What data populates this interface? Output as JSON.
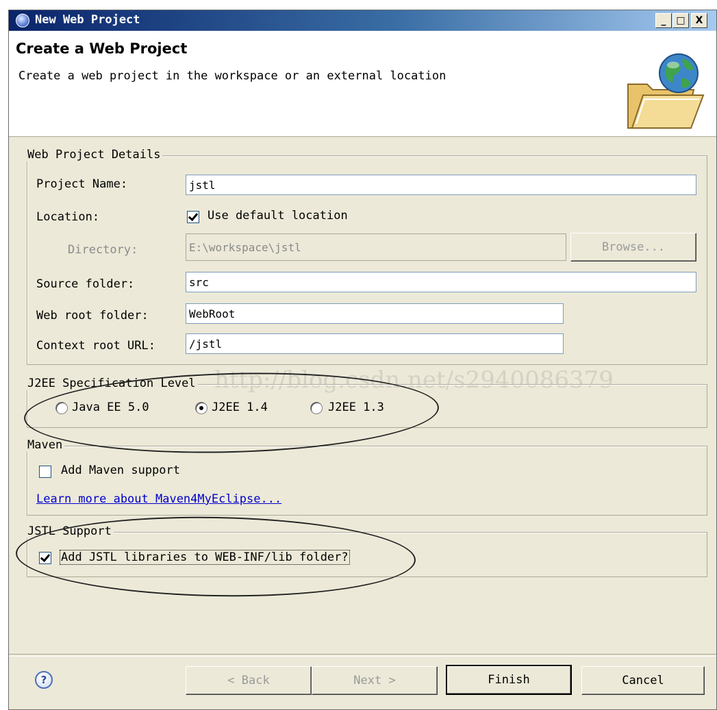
{
  "window": {
    "title": "New Web Project",
    "buttons": {
      "minimize": "_",
      "maximize": "□",
      "close": "X"
    }
  },
  "header": {
    "title": "Create a Web Project",
    "description": "Create a web project in the workspace or an external location"
  },
  "details": {
    "legend": "Web Project Details",
    "project_name_label": "Project Name:",
    "project_name_value": "jstl",
    "location_label": "Location:",
    "use_default_label": "Use default location",
    "use_default_checked": true,
    "directory_label": "Directory:",
    "directory_value": "E:\\workspace\\jstl",
    "browse_label": "Browse...",
    "source_folder_label": "Source folder:",
    "source_folder_value": "src",
    "web_root_label": "Web root folder:",
    "web_root_value": "WebRoot",
    "context_root_label": "Context root URL:",
    "context_root_value": "/jstl"
  },
  "j2ee": {
    "legend": "J2EE Specification Level",
    "options": [
      "Java EE 5.0",
      "J2EE 1.4",
      "J2EE 1.3"
    ],
    "selected": "J2EE 1.4"
  },
  "maven": {
    "legend": "Maven",
    "add_label": "Add Maven support",
    "add_checked": false,
    "learn_more_link": "Learn more about Maven4MyEclipse..."
  },
  "jstl": {
    "legend": "JSTL Support",
    "add_label": "Add JSTL libraries to WEB-INF/lib folder?",
    "add_checked": true
  },
  "footer": {
    "help_symbol": "?",
    "back_label": "< Back",
    "next_label": "Next >",
    "finish_label": "Finish",
    "cancel_label": "Cancel"
  },
  "watermark": "http://blog.csdn.net/s2940086379",
  "colors": {
    "titlebar_start": "#0a246a",
    "titlebar_end": "#a6caf0",
    "dialog_bg": "#ece9d8",
    "link": "#0000cc"
  },
  "icons": [
    "app-globe-icon",
    "folder-globe-icon",
    "help-icon"
  ]
}
